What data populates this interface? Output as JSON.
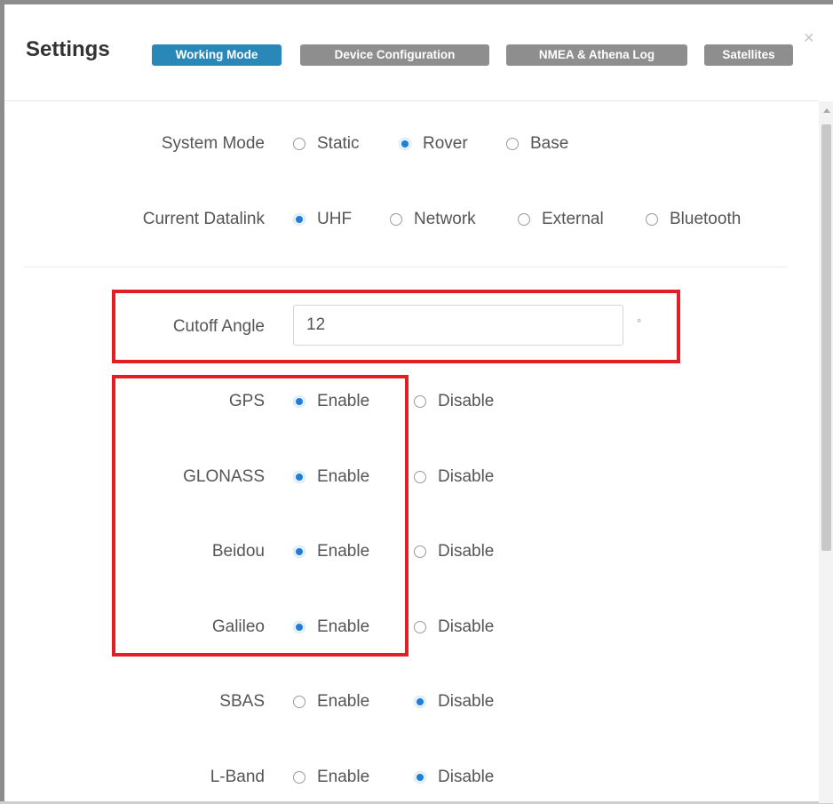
{
  "dialog": {
    "title": "Settings",
    "tabs": [
      {
        "label": "Working Mode",
        "active": true
      },
      {
        "label": "Device Configuration",
        "active": false
      },
      {
        "label": "NMEA & Athena Log",
        "active": false
      },
      {
        "label": "Satellites",
        "active": false
      }
    ],
    "close_symbol": "×"
  },
  "system_mode": {
    "label": "System Mode",
    "options": [
      "Static",
      "Rover",
      "Base"
    ],
    "selected": "Rover"
  },
  "datalink": {
    "label": "Current Datalink",
    "options": [
      "UHF",
      "Network",
      "External",
      "Bluetooth"
    ],
    "selected": "UHF"
  },
  "cutoff": {
    "label": "Cutoff Angle",
    "value": "12",
    "unit": "°"
  },
  "constellations": [
    {
      "label": "GPS",
      "enable": "Enable",
      "disable": "Disable",
      "selected": "Enable"
    },
    {
      "label": "GLONASS",
      "enable": "Enable",
      "disable": "Disable",
      "selected": "Enable"
    },
    {
      "label": "Beidou",
      "enable": "Enable",
      "disable": "Disable",
      "selected": "Enable"
    },
    {
      "label": "Galileo",
      "enable": "Enable",
      "disable": "Disable",
      "selected": "Enable"
    },
    {
      "label": "SBAS",
      "enable": "Enable",
      "disable": "Disable",
      "selected": "Disable"
    },
    {
      "label": "L-Band",
      "enable": "Enable",
      "disable": "Disable",
      "selected": "Disable"
    }
  ],
  "colors": {
    "active_tab": "#2a88b9",
    "inactive_tab": "#8e8e8e",
    "radio_selected": "#1e7ed8",
    "highlight_box": "#e31e24"
  }
}
